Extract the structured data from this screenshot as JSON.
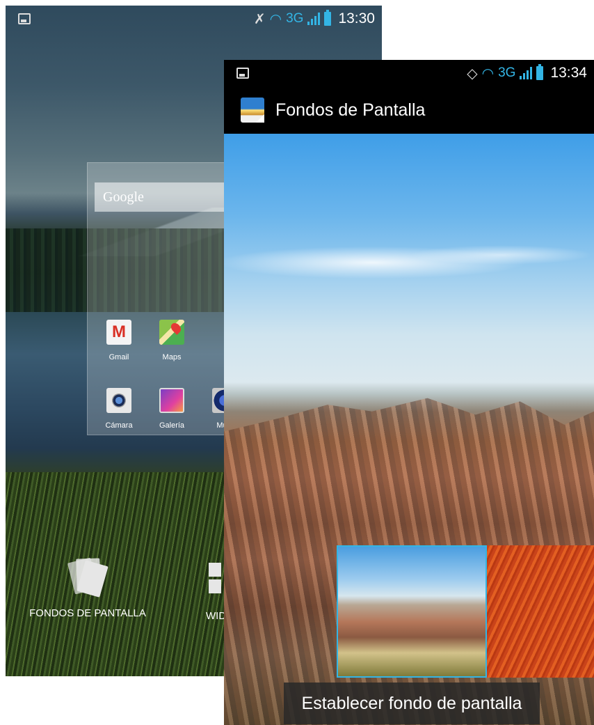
{
  "back_screen": {
    "status_bar": {
      "time": "13:30",
      "network": "3G"
    },
    "search_bar": {
      "label": "Google"
    },
    "apps": [
      {
        "label": "Gmail",
        "icon": "gmail-icon"
      },
      {
        "label": "Maps",
        "icon": "maps-icon"
      },
      {
        "label": "Cámara",
        "icon": "camera-icon"
      },
      {
        "label": "Galería",
        "icon": "gallery-icon"
      },
      {
        "label": "Músi",
        "icon": "music-icon"
      }
    ],
    "options": {
      "wallpapers_label": "FONDOS DE PANTALLA",
      "widgets_label": "WID"
    }
  },
  "front_screen": {
    "status_bar": {
      "time": "13:34",
      "network": "3G"
    },
    "action_bar": {
      "title": "Fondos de Pantalla"
    },
    "set_button_label": "Establecer fondo de pantalla"
  },
  "colors": {
    "accent": "#33b5e5",
    "status_bar_bg": "#000000",
    "button_bg": "#282828"
  }
}
